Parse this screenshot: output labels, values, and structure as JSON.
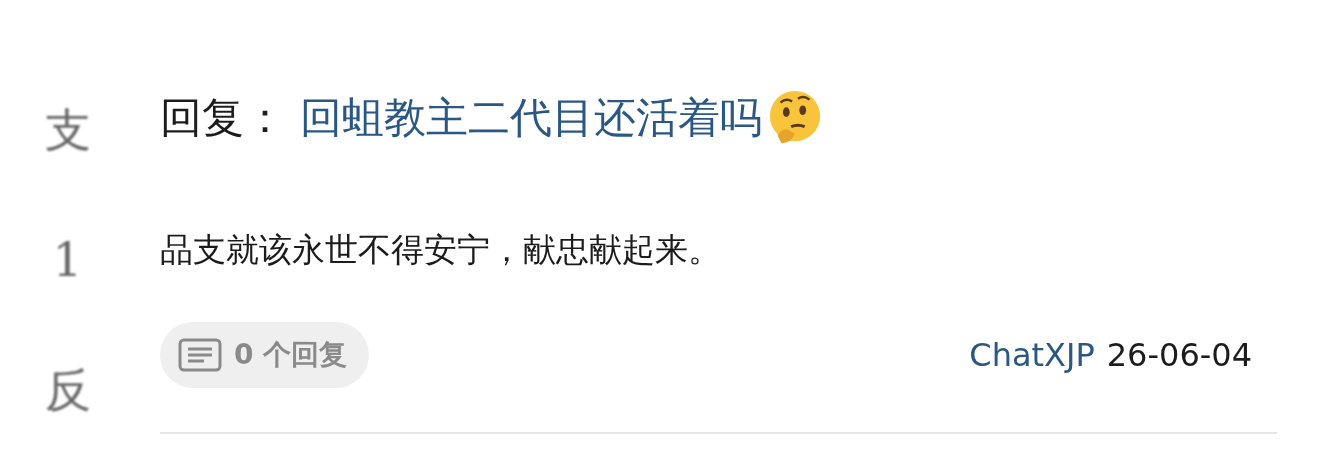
{
  "side_characters": [
    "支",
    "1",
    "反"
  ],
  "post": {
    "title_prefix": "回复：",
    "title_link": "回蛆教主二代目还活着吗",
    "body": "品支就该永世不得安宁，献忠献起来。",
    "reply_count": "0 个回复",
    "author": "ChatXJP",
    "date": "26-06-04"
  }
}
